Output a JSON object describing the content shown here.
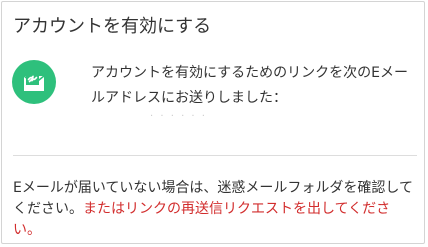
{
  "dialog": {
    "title": "アカウントを有効にする",
    "icon": "email-link-icon",
    "message": "アカウントを有効にするためのリンクを次のEメールアドレスにお送りしました：",
    "email_placeholder": "· · · · · ·",
    "help_text": "Eメールが届いていない場合は、迷惑メールフォルダを確認してください。",
    "resend_link": "またはリンクの再送信リクエストを出してください。"
  },
  "colors": {
    "accent_green": "#2ec07c",
    "link_red": "#d22d2d",
    "text": "#333333"
  }
}
